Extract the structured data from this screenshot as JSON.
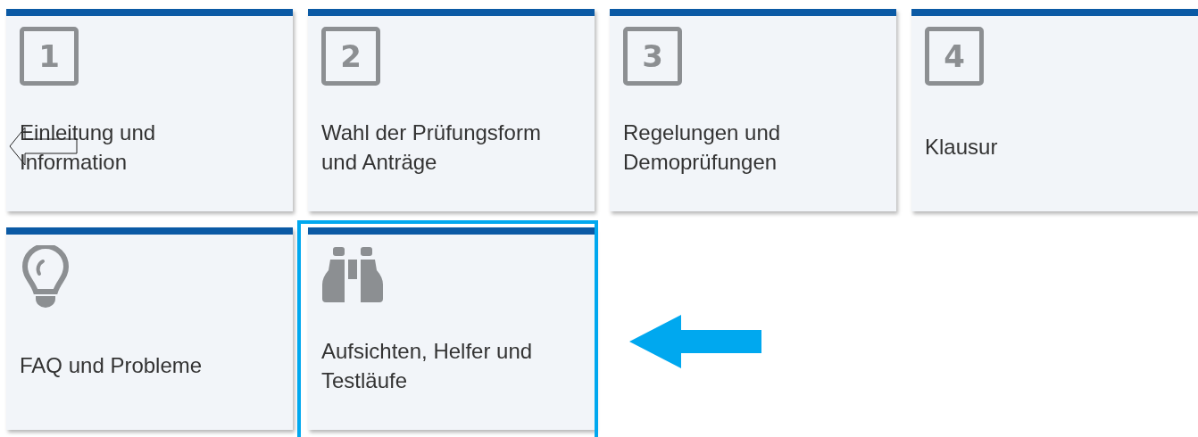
{
  "tiles": [
    {
      "kind": "number",
      "number": "1",
      "label": "Einleitung und Information",
      "highlighted": false,
      "outline_arrow": true,
      "pointer_arrow": false
    },
    {
      "kind": "number",
      "number": "2",
      "label": "Wahl der Prüfungsform und Anträge",
      "highlighted": false,
      "outline_arrow": false,
      "pointer_arrow": false
    },
    {
      "kind": "number",
      "number": "3",
      "label": "Regelungen und Demoprüfungen",
      "highlighted": false,
      "outline_arrow": false,
      "pointer_arrow": false
    },
    {
      "kind": "number",
      "number": "4",
      "label": "Klausur",
      "highlighted": false,
      "outline_arrow": false,
      "pointer_arrow": false
    },
    {
      "kind": "bulb",
      "label": "FAQ und Probleme",
      "highlighted": false,
      "outline_arrow": false,
      "pointer_arrow": false
    },
    {
      "kind": "binoculars",
      "label": "Aufsichten, Helfer und Testläufe",
      "highlighted": true,
      "outline_arrow": false,
      "pointer_arrow": true
    }
  ]
}
